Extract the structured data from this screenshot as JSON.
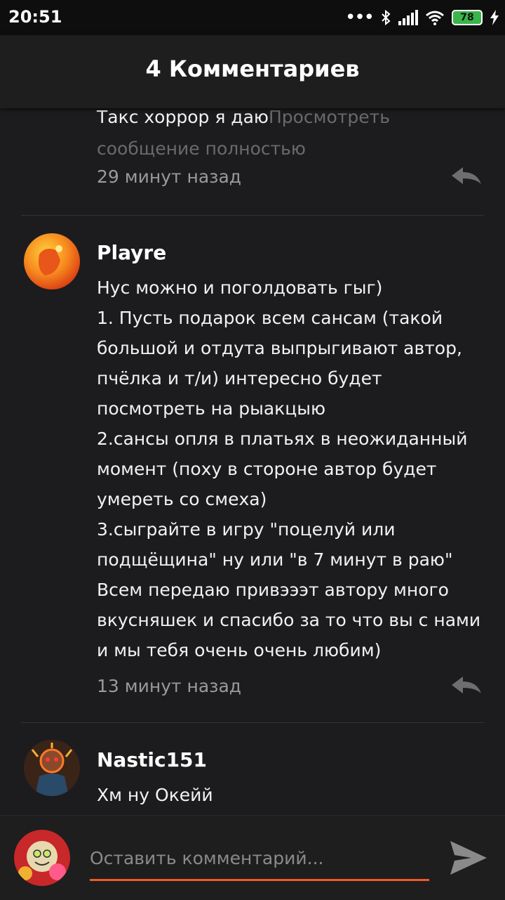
{
  "status_bar": {
    "time": "20:51",
    "battery": "78",
    "icons": [
      "more-dots-icon",
      "bluetooth-icon",
      "signal-icon",
      "wifi-icon",
      "battery-icon",
      "charging-icon"
    ]
  },
  "header": {
    "title": "4 Комментариев"
  },
  "comments": [
    {
      "text": "Такс хоррор я даю",
      "more_link": "Просмотреть сообщение полностью",
      "time": "29 минут назад"
    },
    {
      "author": "Playre",
      "text": "Нус можно и поголдовать гыг)\n1. Пусть подарок всем сансам (такой большой и отдута выпрыгивают автор, пчёлка и т/и) интересно будет посмотреть на рыакцыю\n2.сансы опля в платьях в неожиданный момент (поху в стороне автор будет умереть со смеха)\n3.сыграйте в игру \"поцелуй или подщёщина\" ну или \"в 7 минут в раю\"\nВсем передаю привэээт автору много вкусняшек и спасибо за то что вы с нами и мы тебя очень очень любим)",
      "time": "13 минут назад"
    },
    {
      "author": "Nastic151",
      "text": "Хм ну Окейй"
    }
  ],
  "input": {
    "placeholder": "Оставить комментарий..."
  },
  "colors": {
    "accent": "#f05a28",
    "background": "#1c1c1e",
    "header": "#1e1e1e"
  }
}
